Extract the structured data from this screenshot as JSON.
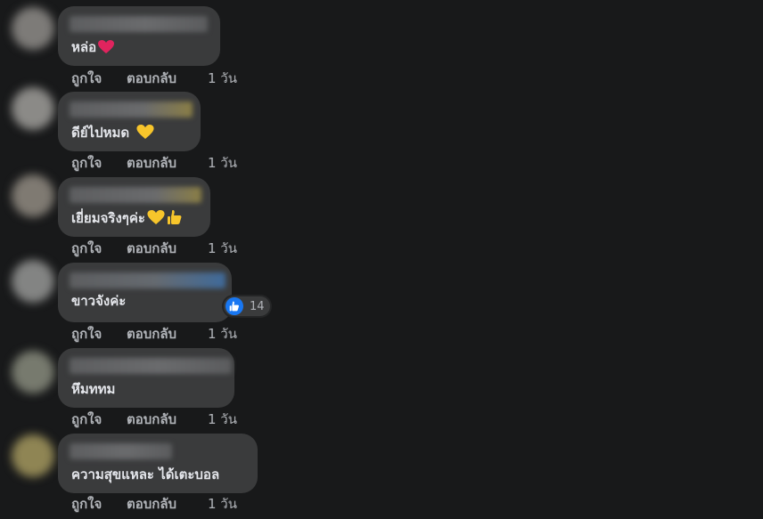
{
  "actions": {
    "like_label": "ถูกใจ",
    "reply_label": "ตอบกลับ"
  },
  "comments": [
    {
      "text": "หล่อ",
      "emojis": [
        "red-heart"
      ],
      "time": "1 วัน"
    },
    {
      "text": "ดีย์ไปหมด",
      "emojis": [
        "yellow-heart"
      ],
      "time": "1 วัน"
    },
    {
      "text": "เยี่ยมจริงๆค่ะ",
      "emojis": [
        "yellow-heart",
        "thumbs-up"
      ],
      "time": "1 วัน"
    },
    {
      "text": "ขาวจังค่ะ",
      "emojis": [],
      "time": "1 วัน",
      "reaction": {
        "type": "like-icon",
        "count": "14"
      }
    },
    {
      "text": "หึมททม",
      "emojis": [],
      "time": "1 วัน"
    },
    {
      "text": "ความสุขแหละ ได้เตะบอล",
      "emojis": [],
      "time": "1 วัน"
    }
  ],
  "colors": {
    "page_background": "#18191a",
    "bubble": "#3a3b3c",
    "text": "#e4e6eb",
    "secondary_text": "#b0b3b8",
    "like_blue": "#1877f2"
  }
}
